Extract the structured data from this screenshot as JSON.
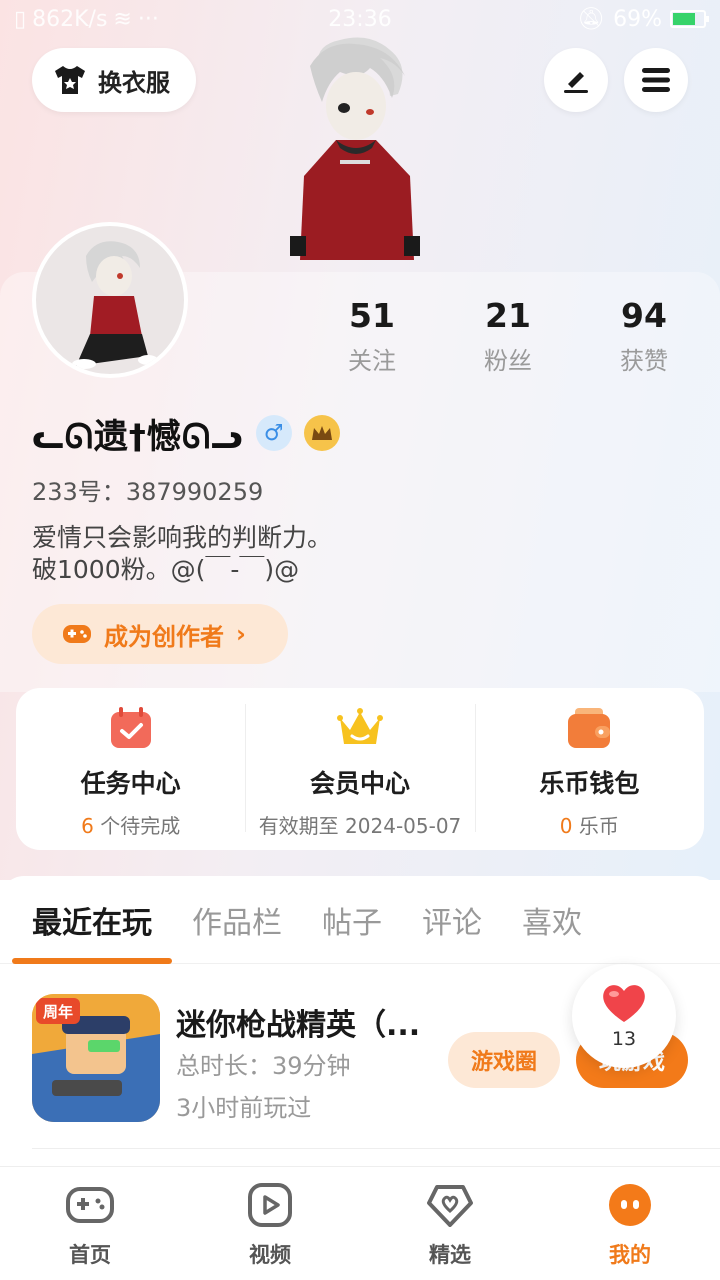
{
  "statusbar": {
    "network_speed": "862K/s",
    "time": "23:36",
    "battery": "69%"
  },
  "header": {
    "dress_label": "换衣服",
    "edit_icon": "pencil-icon",
    "menu_icon": "hamburger-menu-icon"
  },
  "stats": [
    {
      "value": "51",
      "label": "关注"
    },
    {
      "value": "21",
      "label": "粉丝"
    },
    {
      "value": "94",
      "label": "获赞"
    }
  ],
  "profile": {
    "nickname": "ᓚᘏ遗†憾ᘏᓗ",
    "gender_symbol": "♂",
    "uid": "233号：387990259",
    "bio": "爱情只会影响我的判断力。\n破1000粉。@(￣-￣)@",
    "creator_label": "成为创作者"
  },
  "features": [
    {
      "title": "任务中心",
      "highlight": "6",
      "sub": " 个待完成",
      "icon": "task-calendar-icon",
      "color": "#f26a5a"
    },
    {
      "title": "会员中心",
      "highlight": "",
      "sub": "有效期至 2024-05-07",
      "icon": "vip-crown-icon",
      "color": "#f5b820"
    },
    {
      "title": "乐币钱包",
      "highlight": "0",
      "sub": " 乐币",
      "icon": "wallet-icon",
      "color": "#f27d3a"
    }
  ],
  "tabs": [
    "最近在玩",
    "作品栏",
    "帖子",
    "评论",
    "喜欢"
  ],
  "recent_game": {
    "title": "迷你枪战精英（...",
    "duration": "总时长：39分钟",
    "last_played": "3小时前玩过",
    "circle_label": "游戏圈",
    "play_label": "玩游戏",
    "badge": "周年"
  },
  "like_float": {
    "count": "13"
  },
  "bottom_nav": [
    {
      "label": "首页",
      "icon": "gamepad-icon"
    },
    {
      "label": "视频",
      "icon": "video-play-icon"
    },
    {
      "label": "精选",
      "icon": "heart-shield-icon"
    },
    {
      "label": "我的",
      "icon": "profile-face-icon"
    }
  ],
  "colors": {
    "accent": "#f07a1a",
    "accent_light": "#fde8d6"
  }
}
